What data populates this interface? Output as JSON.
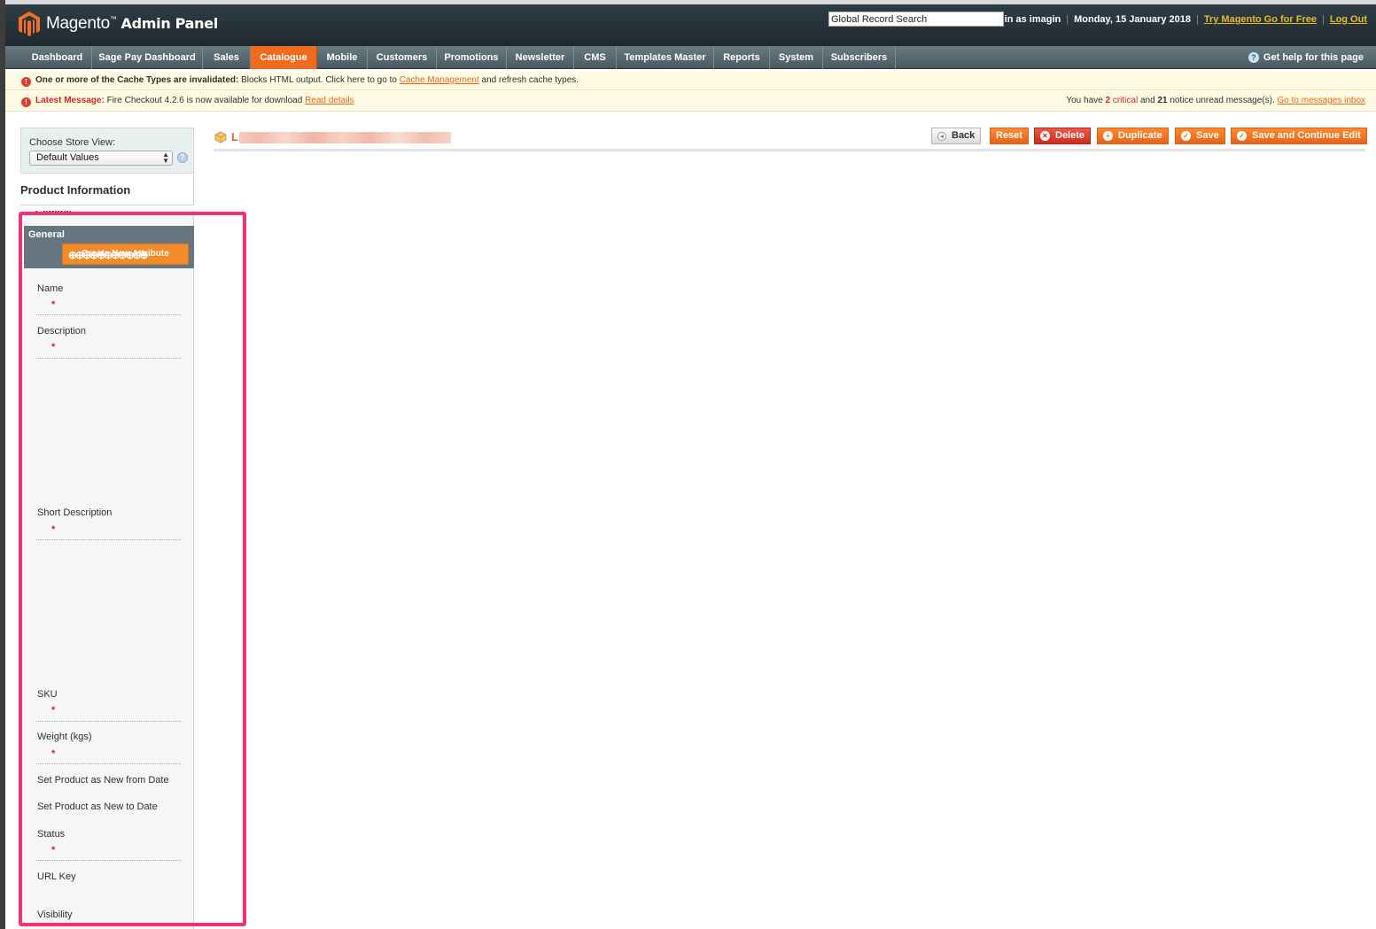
{
  "header": {
    "logo_main": "Magento",
    "logo_sub": "Admin Panel",
    "search_value": "Global Record Search",
    "logged_in": "Logged in as imagin",
    "date": "Monday, 15 January 2018",
    "try_link": "Try Magento Go for Free",
    "logout": "Log Out",
    "separator": "|"
  },
  "nav": {
    "items": [
      {
        "label": "Dashboard"
      },
      {
        "label": "Sage Pay Dashboard"
      },
      {
        "label": "Sales"
      },
      {
        "label": "Catalogue"
      },
      {
        "label": "Mobile"
      },
      {
        "label": "Customers"
      },
      {
        "label": "Promotions"
      },
      {
        "label": "Newsletter"
      },
      {
        "label": "CMS"
      },
      {
        "label": "Templates Master"
      },
      {
        "label": "Reports"
      },
      {
        "label": "System"
      },
      {
        "label": "Subscribers"
      }
    ],
    "active": "Catalogue",
    "help": "Get help for this page"
  },
  "messages": {
    "cache_bold": "One or more of the Cache Types are invalidated:",
    "cache_text": " Blocks HTML output. Click here to go to ",
    "cache_link": "Cache Management",
    "cache_tail": " and refresh cache types.",
    "latest_label": "Latest Message:",
    "latest_text": " Fire Checkout 4.2.6 is now available for download ",
    "latest_link": "Read details",
    "right_1": "You have ",
    "critical_count": "2",
    "critical_word": "critical",
    "right_2": " and ",
    "notice_count": "21",
    "right_3": " notice unread message(s). ",
    "inbox_link": "Go to messages inbox"
  },
  "sidebar": {
    "store_label": "Choose Store View:",
    "store_value": "Default Values",
    "product_info": "Product Information",
    "general_cut": "General",
    "general_title": "General",
    "create_attr": "Create New Attribute",
    "fields": [
      {
        "label": "Name",
        "required": "*"
      },
      {
        "label": "Description",
        "required": "*"
      },
      {
        "label": "Short Description",
        "required": "*"
      },
      {
        "label": "SKU",
        "required": "*"
      },
      {
        "label": "Weight (kgs)",
        "required": "*"
      },
      {
        "label": "Set Product as New from Date"
      },
      {
        "label": "Set Product as New to Date"
      },
      {
        "label": "Status",
        "required": "*"
      },
      {
        "label": "URL Key"
      },
      {
        "label": "Visibility"
      }
    ]
  },
  "content": {
    "title_initial": "L",
    "buttons": {
      "back": "Back",
      "reset": "Reset",
      "delete": "Delete",
      "duplicate": "Duplicate",
      "save": "Save",
      "save_continue": "Save and Continue Edit"
    }
  },
  "colors": {
    "accent": "#f06b1e",
    "header_bg": "#2f3d44",
    "highlight": "#f2317a",
    "required": "#e41c1c"
  }
}
